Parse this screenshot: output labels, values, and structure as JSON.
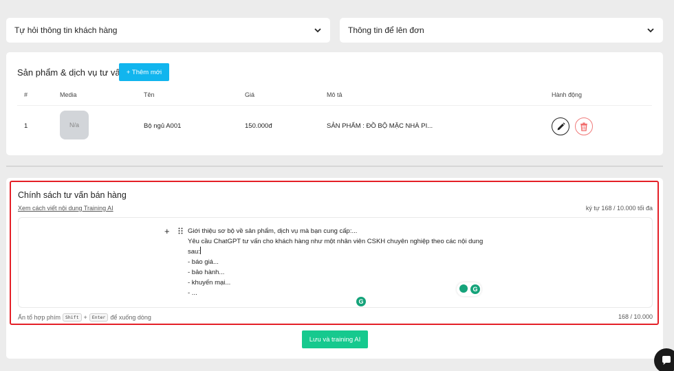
{
  "accordions": [
    {
      "label": "Tự hỏi thông tin khách hàng"
    },
    {
      "label": "Thông tin để lên đơn"
    }
  ],
  "products": {
    "title": "Sản phẩm & dịch vụ tư vấn",
    "add_label": "+ Thêm mới",
    "columns": [
      "#",
      "Media",
      "Tên",
      "Giá",
      "Mô tả",
      "Hành động"
    ],
    "rows": [
      {
        "index": "1",
        "media": "N/a",
        "name": "Bộ ngủ A001",
        "price": "150.000đ",
        "description": "SẢN PHẨM : ĐỒ BỘ MẶC NHÀ PI..."
      }
    ]
  },
  "policy": {
    "title": "Chính sách tư vấn bán hàng",
    "guide_link": "Xem cách viết nội dung Training AI",
    "char_limit": "ký tự 168 / 10.000 tối đa",
    "editor_lines": [
      "Giới thiệu sơ bộ về sản phẩm, dịch vụ mà bạn cung cấp:...",
      "Yêu cầu ChatGPT tư vấn cho khách hàng như một nhân viên CSKH chuyên nghiệp theo các nội dung",
      "sau:",
      "- báo giá...",
      "- bảo hành...",
      "- khuyến mại...",
      "- ..."
    ],
    "hint_prefix": "Ấn tổ hợp phím",
    "hint_key1": "Shift",
    "hint_plus": "+",
    "hint_key2": "Enter",
    "hint_suffix": "để xuống dòng",
    "counter": "168 / 10.000",
    "save_label": "Lưu và training AI"
  },
  "grammarly_letter": "G",
  "colors": {
    "accent_blue": "#11b5ee",
    "save_green": "#16c98e",
    "highlight_red": "#e41e26",
    "delete_red": "#f07a7a"
  },
  "icons": {
    "accordion": "chevron-down-icon",
    "edit": "pencil-icon",
    "delete": "trash-icon",
    "chat": "chat-bubble-icon"
  }
}
